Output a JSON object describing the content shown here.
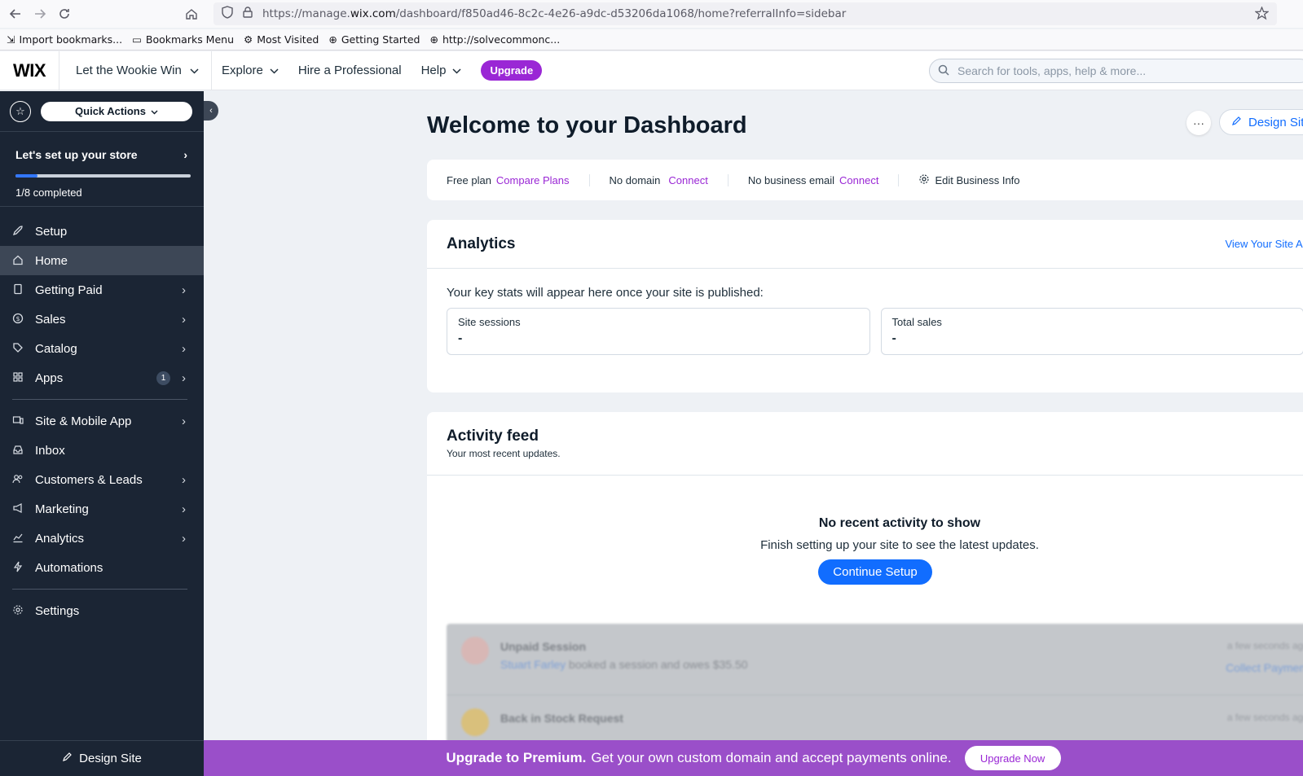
{
  "browser": {
    "url_prefix": "https://manage.",
    "url_domain": "wix.com",
    "url_rest": "/dashboard/f850ad46-8c2c-4e26-a9dc-d53206da1068/home?referralInfo=sidebar",
    "bookmarks": [
      "Import bookmarks...",
      "Bookmarks Menu",
      "Most Visited",
      "Getting Started",
      "http://solvecommonc..."
    ]
  },
  "topbar": {
    "logo": "WIX",
    "site_name": "Let the Wookie Win",
    "explore": "Explore",
    "hire": "Hire a Professional",
    "help": "Help",
    "upgrade": "Upgrade",
    "search_placeholder": "Search for tools, apps, help & more..."
  },
  "sidebar": {
    "quick_actions": "Quick Actions",
    "setup_title": "Let's set up your store",
    "setup_progress_fraction": 0.125,
    "setup_sub": "1/8 completed",
    "items": [
      {
        "label": "Setup",
        "icon": "rocket-icon"
      },
      {
        "label": "Home",
        "icon": "home-icon"
      },
      {
        "label": "Getting Paid",
        "icon": "receipt-icon"
      },
      {
        "label": "Sales",
        "icon": "dollar-icon"
      },
      {
        "label": "Catalog",
        "icon": "tag-icon"
      },
      {
        "label": "Apps",
        "icon": "apps-icon",
        "badge": "1"
      },
      {
        "label": "Site & Mobile App",
        "icon": "devices-icon"
      },
      {
        "label": "Inbox",
        "icon": "inbox-icon"
      },
      {
        "label": "Customers & Leads",
        "icon": "people-icon"
      },
      {
        "label": "Marketing",
        "icon": "megaphone-icon"
      },
      {
        "label": "Analytics",
        "icon": "chart-icon"
      },
      {
        "label": "Automations",
        "icon": "bolt-icon"
      },
      {
        "label": "Settings",
        "icon": "gear-icon"
      }
    ],
    "footer": "Design Site"
  },
  "main": {
    "title": "Welcome to your Dashboard",
    "more": "···",
    "design_site": "Design Sit",
    "info_bar": {
      "free_plan": "Free plan",
      "compare_plans": "Compare Plans",
      "no_domain": "No domain",
      "connect_domain": "Connect",
      "no_email": "No business email",
      "connect_email": "Connect",
      "edit_business": "Edit Business Info"
    },
    "analytics": {
      "title": "Analytics",
      "link": "View Your Site Analytics",
      "note": "Your key stats will appear here once your site is published:",
      "stats": [
        {
          "label": "Site sessions",
          "value": "-"
        },
        {
          "label": "Total sales",
          "value": "-"
        }
      ]
    },
    "activity": {
      "title": "Activity feed",
      "subtitle": "Your most recent updates.",
      "empty_title": "No recent activity to show",
      "empty_sub": "Finish setting up your site to see the latest updates.",
      "continue": "Continue Setup",
      "blurred": [
        {
          "title": "Unpaid Session",
          "name": "Stuart Farley",
          "text": " booked a session and owes $35.50",
          "time": "a few seconds ago",
          "action": "Collect Payment"
        },
        {
          "title": "Back in Stock Request",
          "name": "",
          "text": "",
          "time": "a few seconds ago",
          "action": ""
        }
      ]
    }
  },
  "banner": {
    "bold": "Upgrade to Premium.",
    "message": "Get your own custom domain and accept payments online.",
    "button": "Upgrade Now"
  }
}
